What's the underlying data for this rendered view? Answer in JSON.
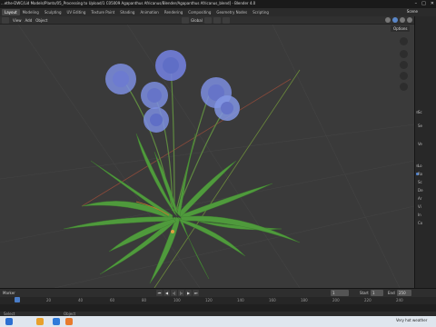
{
  "window": {
    "title": "...ethe-DWC/Lid Models/Plants/05_Processing to Upload/1 C05009 Agapanthus Africanus/Blender/Agapanthus Africanus_blend] - Blender 4.0"
  },
  "workspace_tabs": [
    "Layout",
    "Modeling",
    "Sculpting",
    "UV Editing",
    "Texture Paint",
    "Shading",
    "Animation",
    "Rendering",
    "Compositing",
    "Geometry Nodes",
    "Scripting"
  ],
  "active_tab": "Layout",
  "scene_label": "Scene",
  "viewport_header": {
    "menus": [
      "View",
      "Add",
      "Object"
    ],
    "orientation": "Global"
  },
  "viewport": {
    "options_label": "Options",
    "background_color": "#3a3a3a"
  },
  "sidebar": {
    "labels": [
      "Sc",
      "Se",
      "Ve",
      "Lo",
      "Ro",
      "Sc",
      "De",
      "Ar",
      "Vi",
      "In",
      "Co"
    ]
  },
  "timeline": {
    "label": "Marker",
    "current_frame": "1",
    "start_label": "Start",
    "start_value": "1",
    "end_label": "End",
    "end_value": "250",
    "ticks": [
      "0",
      "20",
      "40",
      "60",
      "80",
      "100",
      "120",
      "140",
      "160",
      "180",
      "200",
      "220",
      "240"
    ]
  },
  "statusbar": {
    "left": "Select",
    "mid": "Object"
  },
  "taskbar": {
    "weather_text": "Very hot weather"
  },
  "colors": {
    "accent": "#4a7dc9",
    "leaf": "#4f9a3c",
    "flower": "#7c8ee0"
  }
}
